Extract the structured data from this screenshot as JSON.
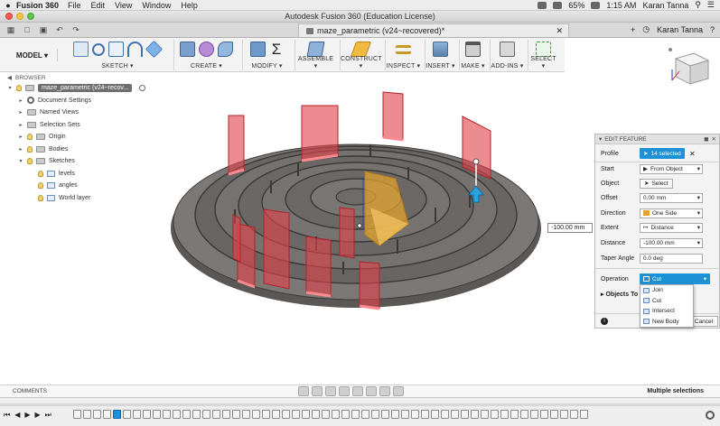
{
  "menubar": {
    "app_name": "Fusion 360",
    "items": [
      "File",
      "Edit",
      "View",
      "Window",
      "Help"
    ],
    "battery": "65%",
    "time": "1:15 AM",
    "user": "Karan Tanna"
  },
  "window": {
    "title": "Autodesk Fusion 360 (Education License)"
  },
  "tabs": {
    "document": "maze_parametric (v24~recovered)*",
    "user": "Karan Tanna"
  },
  "toolbar": {
    "mode": "MODEL",
    "groups": [
      "SKETCH",
      "CREATE",
      "MODIFY",
      "ASSEMBLE",
      "CONSTRUCT",
      "INSPECT",
      "INSERT",
      "MAKE",
      "ADD-INS",
      "SELECT"
    ]
  },
  "browser": {
    "header": "BROWSER",
    "root": "maze_parametric (v24~recov...",
    "items": [
      "Document Settings",
      "Named Views",
      "Selection Sets",
      "Origin",
      "Bodies",
      "Sketches"
    ],
    "sketches": [
      "levels",
      "angles",
      "World layer"
    ]
  },
  "dimension": {
    "value": "-100.00 mm"
  },
  "edit_feature": {
    "title": "EDIT FEATURE",
    "rows": [
      {
        "label": "Profile",
        "value": "14 selected"
      },
      {
        "label": "Start",
        "value": "From Object"
      },
      {
        "label": "Object",
        "value": "Select"
      },
      {
        "label": "Offset",
        "value": "0.00 mm"
      },
      {
        "label": "Direction",
        "value": "One Side"
      },
      {
        "label": "Extent",
        "value": "Distance"
      },
      {
        "label": "Distance",
        "value": "-100.00 mm"
      },
      {
        "label": "Taper Angle",
        "value": "0.0 deg"
      }
    ],
    "operation_label": "Operation",
    "operation_value": "Cut",
    "objects_to_cut": "Objects To C",
    "cancel": "Cancel"
  },
  "operation_menu": {
    "options": [
      "Join",
      "Cut",
      "Intersect",
      "New Body"
    ]
  },
  "bottom": {
    "comments": "COMMENTS",
    "status": "Multiple selections"
  },
  "colors": {
    "accent": "#1e90d6",
    "maze_body": "#6b6866",
    "cut_profile": "#e0444c",
    "direction_plane": "#e5a32c"
  }
}
